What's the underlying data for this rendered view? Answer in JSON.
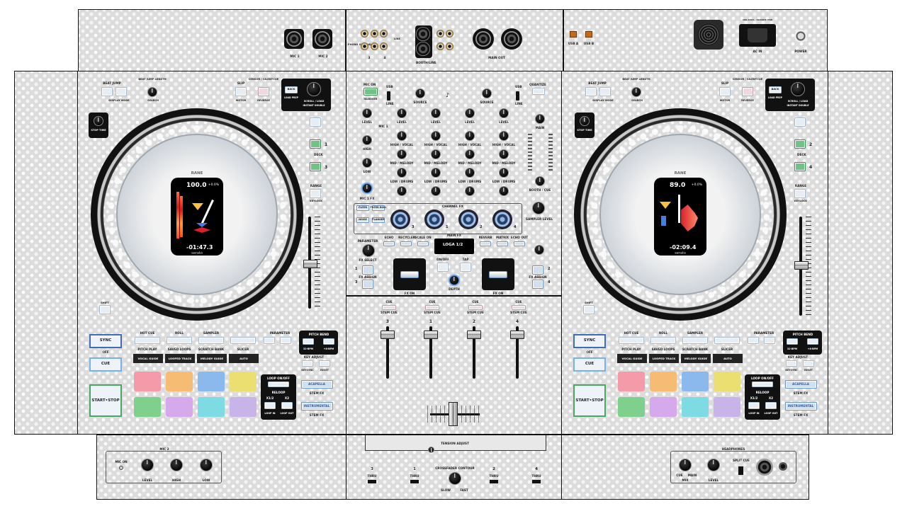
{
  "rear_panel": {
    "mic1": "MIC 1",
    "mic2": "MIC 2",
    "phono_gnd": "PHONO GROUND",
    "input3": "3",
    "input4": "4",
    "line": "LINE",
    "phono": "PHONO",
    "booth_line": "BOOTH/LINE",
    "main_out": "MAIN OUT",
    "usb_a": "USB A",
    "usb_b": "USB B",
    "ac_in": "AC IN",
    "power": "POWER",
    "ac_rating": "100-240V~ 50/60Hz 35W"
  },
  "left_deck": {
    "beat_jump": "BEAT JUMP",
    "beat_jump_length": "BEAT JUMP LENGTH",
    "display_mode": "DISPLAY MODE",
    "search": "SEARCH",
    "slip": "SLIP",
    "motor": "MOTOR",
    "censor": "CENSOR / SILENTCUE",
    "reverse": "REVERSE",
    "back": "BACK",
    "load_prep": "LOAD PREP",
    "scroll_load": "SCROLL / LOAD",
    "instant_double": "INSTANT DOUBLE",
    "stop_time": "STOP TIME",
    "deck1": "1",
    "deck3": "3",
    "deck_label": "DECK",
    "range": "RANGE",
    "keylock": "KEYLOCK",
    "shift": "SHIFT",
    "sync": "SYNC",
    "off": "OFF",
    "cue": "CUE",
    "start_stop": "START•STOP",
    "hot_cue": "HOT CUE",
    "roll": "ROLL",
    "sampler": "SAMPLER",
    "parameter": "PARAMETER",
    "pitch_bend": "PITCH BEND",
    "bpm_minus": "32-BPM",
    "bpm_plus": "+8-BPM",
    "pitch_play": "PITCH PLAY",
    "saved_loops": "SAVED LOOPS",
    "scratch_bank": "SCRATCH BANK",
    "slicer": "SLICER",
    "sub1": "VOCAL GUIDE",
    "sub2": "LOOPED TRACK",
    "sub3": "MELODY GUIDE",
    "sub4": "AUTO",
    "key_adjust": "KEY ADJUST",
    "keysync": "KEYSYNC",
    "reset": "RESET",
    "loop_onoff": "LOOP ON/OFF",
    "reloop": "RELOOP",
    "half": "x1/2",
    "double": "x2",
    "loop_in": "LOOP IN",
    "loop_out": "LOOP OUT",
    "acapella": "ACAPELLA",
    "stem_fx": "STEM FX",
    "instrumental": "INSTRUMENTAL",
    "stem_fx2": "STEM FX",
    "screen": {
      "bpm": "100.0",
      "pitch": "+0.0%",
      "time": "-01:47.3",
      "brand": "serato",
      "logo": "RANE"
    }
  },
  "right_deck": {
    "deck2": "2",
    "deck4": "4",
    "screen": {
      "bpm": "89.0",
      "pitch": "+0.0%",
      "time": "-02:09.4",
      "brand": "serato",
      "logo": "RANE"
    }
  },
  "mixer": {
    "mic_on": "MIC ON",
    "usb": "USB",
    "line": "LINE",
    "source": "SOURCE",
    "quantize": "QUANTIZE",
    "talkover": "TALKOVER",
    "level": "LEVEL",
    "mic1": "MIC 1",
    "high": "HIGH",
    "high_vocal": "HIGH / VOCAL",
    "mid_melody": "MID / MELODY",
    "low": "LOW",
    "low_drums": "LOW / DRUMS",
    "mic1fx": "MIC 1 FX",
    "main": "MAIN",
    "booth": "BOOTH / CUE",
    "filter": "FILTER",
    "filter_roll": "FILTER ROLL",
    "noise": "NOISE",
    "flanger": "FLANGER",
    "channel_fx": "CHANNEL FX",
    "sampler_level": "SAMPLER LEVEL",
    "parameter": "PARAMETER",
    "fx_select": "FX SELECT",
    "echo": "ECHO",
    "recycler": "RECYCLER",
    "scale_on": "SCALE ON",
    "main_fx": "MAIN FX",
    "reverb": "REVERB",
    "matrix": "MATRIX",
    "echo_out": "ECHO OUT",
    "display": "LOGA 1/2",
    "on_off": "ON/OFF",
    "tap": "TAP",
    "depth": "DEPTH",
    "fx_assign": "FX ASSIGN",
    "fx_on": "FX ON",
    "ch1": "1",
    "ch2": "2",
    "ch3": "3",
    "ch4": "4",
    "cue_label": "CUE",
    "stem_cue": "STEM CUE"
  },
  "front_panel": {
    "mic2": "MIC 2",
    "mic_on": "MIC ON",
    "level": "LEVEL",
    "high": "HIGH",
    "low": "LOW",
    "tension_adjust": "TENSION ADJUST",
    "crossfader_contour": "CROSSFADER CONTOUR",
    "slow": "SLOW",
    "fast": "FAST",
    "thru": "THRU",
    "headphones": "HEADPHONES",
    "cue": "CUE",
    "mix": "MIX",
    "main": "MAIN",
    "level_hp": "LEVEL",
    "split_cue": "SPLIT CUE",
    "ch3": "3",
    "ch1": "1",
    "ch2": "2",
    "ch4": "4"
  },
  "pad_colors": [
    "#f49aa8",
    "#f6bc74",
    "#8bb9ee",
    "#ecdf72",
    "#7fd08c",
    "#d6a8ec",
    "#7fdbe3",
    "#c9b4ea"
  ]
}
